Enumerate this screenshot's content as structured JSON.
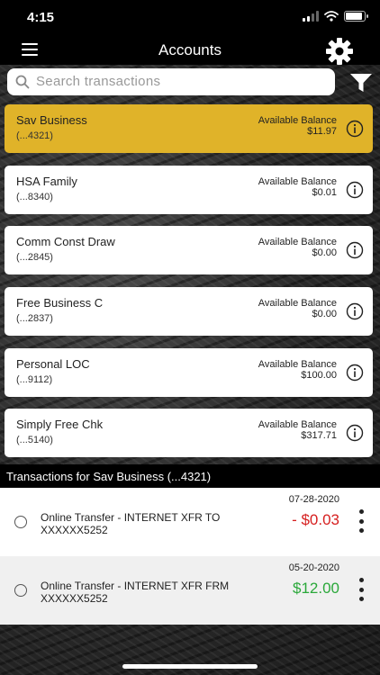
{
  "status": {
    "time": "4:15"
  },
  "nav": {
    "title": "Accounts"
  },
  "search": {
    "placeholder": "Search transactions"
  },
  "accounts": [
    {
      "name": "Sav Business",
      "number": "(...4321)",
      "balance_label": "Available Balance",
      "balance": "$11.97",
      "selected": true
    },
    {
      "name": "HSA Family",
      "number": "(...8340)",
      "balance_label": "Available Balance",
      "balance": "$0.01"
    },
    {
      "name": "Comm Const Draw",
      "number": "(...2845)",
      "balance_label": "Available Balance",
      "balance": "$0.00"
    },
    {
      "name": "Free Business C",
      "number": "(...2837)",
      "balance_label": "Available Balance",
      "balance": "$0.00"
    },
    {
      "name": "Personal LOC",
      "number": "(...9112)",
      "balance_label": "Available Balance",
      "balance": "$100.00"
    },
    {
      "name": "Simply Free Chk",
      "number": "(...5140)",
      "balance_label": "Available Balance",
      "balance": "$317.71"
    }
  ],
  "transactions_header": "Transactions for Sav Business (...4321)",
  "transactions": [
    {
      "date": "07-28-2020",
      "description": "Online Transfer - INTERNET XFR TO XXXXXX5252",
      "amount": "- $0.03",
      "type": "debit"
    },
    {
      "date": "05-20-2020",
      "description": "Online Transfer - INTERNET XFR FRM XXXXXX5252",
      "amount": "$12.00",
      "type": "credit"
    }
  ],
  "colors": {
    "selected_account": "#e0b329",
    "debit": "#d61f1f",
    "credit": "#2aa83a"
  },
  "icons": {
    "menu": "hamburger-icon",
    "settings": "gear-icon",
    "search": "search-icon",
    "filter": "filter-icon",
    "info": "info-icon",
    "more": "kebab-icon"
  }
}
